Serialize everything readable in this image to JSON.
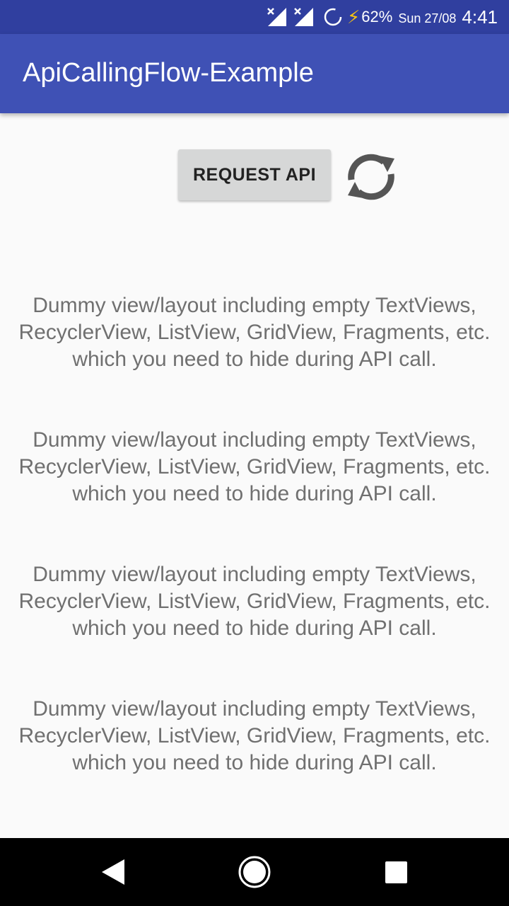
{
  "status_bar": {
    "battery": "62%",
    "date": "Sun 27/08",
    "time": "4:41",
    "icons": [
      "signal-icon",
      "signal-icon",
      "sync-icon",
      "charging-icon"
    ],
    "colors": {
      "background": "#303f9f",
      "charging": "#f9c512"
    }
  },
  "app_bar": {
    "title": "ApiCallingFlow-Example",
    "color": "#3f51b5"
  },
  "main": {
    "request_button_label": "REQUEST API",
    "refresh_icon": "refresh-icon",
    "dummy_texts": [
      "Dummy view/layout including empty TextViews, RecyclerView, ListView, GridView, Fragments, etc. which you need to hide during API call.",
      "Dummy view/layout including empty TextViews, RecyclerView, ListView, GridView, Fragments, etc. which you need to hide during API call.",
      "Dummy view/layout including empty TextViews, RecyclerView, ListView, GridView, Fragments, etc. which you need to hide during API call.",
      "Dummy view/layout including empty TextViews, RecyclerView, ListView, GridView, Fragments, etc. which you need to hide during API call."
    ]
  },
  "nav_bar": {
    "icons": [
      "back-icon",
      "home-icon",
      "recents-icon"
    ]
  }
}
